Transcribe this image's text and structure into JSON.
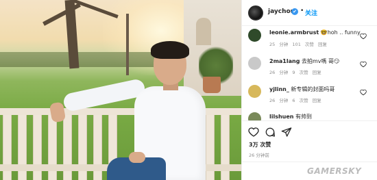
{
  "post": {
    "username": "jaychou",
    "verified_mark": "✔",
    "dot": "•",
    "follow_label": "关注",
    "likes": "3万 次赞",
    "time_ago": "26 分钟前"
  },
  "comments": [
    {
      "user": "leonie.armbrust",
      "text": "🤓hoh .. funny",
      "time": "25 分钟",
      "likes": "101 次赞",
      "reply": "回复",
      "avatar_color": "#2f4a2a"
    },
    {
      "user": "2ma1lang",
      "text": "去拍mv嗎 哥😏",
      "time": "26 分钟",
      "likes": "9 次赞",
      "reply": "回复",
      "avatar_color": "#c9c9c9"
    },
    {
      "user": "yjlinn_",
      "text": "新专辑的封面吗哥",
      "time": "26 分钟",
      "likes": "6 次赞",
      "reply": "回复",
      "avatar_color": "#d7b85b"
    },
    {
      "user": "lilshuen",
      "text": "有帅到",
      "time": "",
      "likes": "",
      "reply": "",
      "avatar_color": "#7a8a5a"
    }
  ],
  "watermark": "GAMERSKY",
  "icons": [
    "heart-icon",
    "comment-icon",
    "share-icon"
  ]
}
